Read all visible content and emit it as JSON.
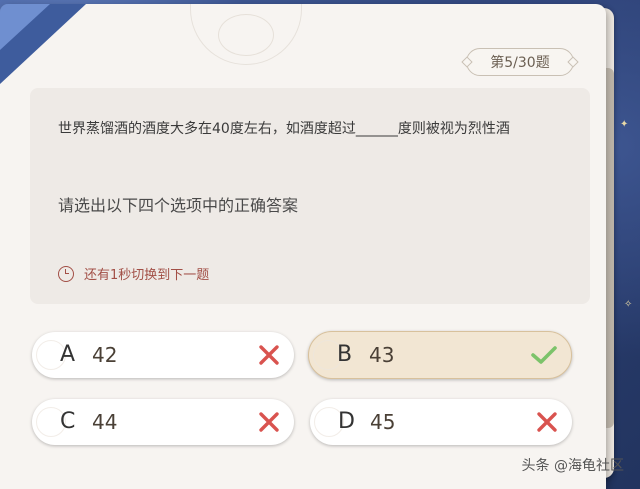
{
  "counter": "第5/30题",
  "question": {
    "text": "世界蒸馏酒的酒度大多在40度左右，如酒度超过______度则被视为烈性酒",
    "instruction": "请选出以下四个选项中的正确答案",
    "timer_text": "还有1秒切换到下一题"
  },
  "options": [
    {
      "letter": "A",
      "value": "42",
      "result": "wrong"
    },
    {
      "letter": "B",
      "value": "43",
      "result": "correct"
    },
    {
      "letter": "C",
      "value": "44",
      "result": "wrong"
    },
    {
      "letter": "D",
      "value": "45",
      "result": "wrong"
    }
  ],
  "watermark": "头条 @海龟社区",
  "colors": {
    "wrong": "#d9534f",
    "correct": "#7cc36a",
    "timer": "#a24f46"
  }
}
